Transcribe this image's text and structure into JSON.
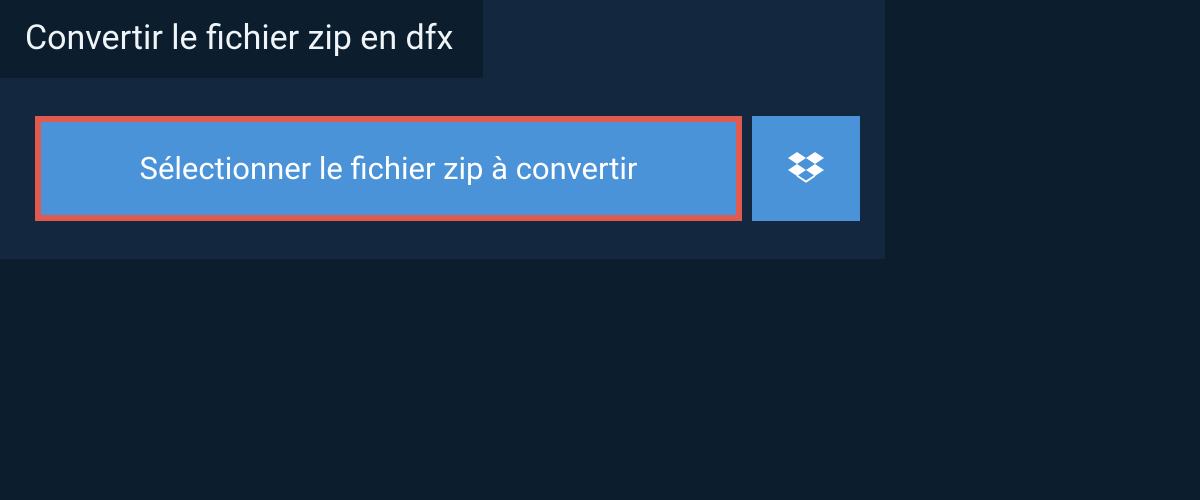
{
  "header": {
    "tab_label": "Convertir le fichier zip en dfx"
  },
  "actions": {
    "select_file_label": "Sélectionner le fichier zip à convertir",
    "dropbox_icon": "dropbox-icon"
  },
  "colors": {
    "page_bg": "#0c1e2e",
    "panel_bg": "#13283f",
    "button_bg": "#4a93d9",
    "highlight_border": "#e05a50",
    "text_light": "#eff4f8",
    "text_white": "#ffffff"
  }
}
